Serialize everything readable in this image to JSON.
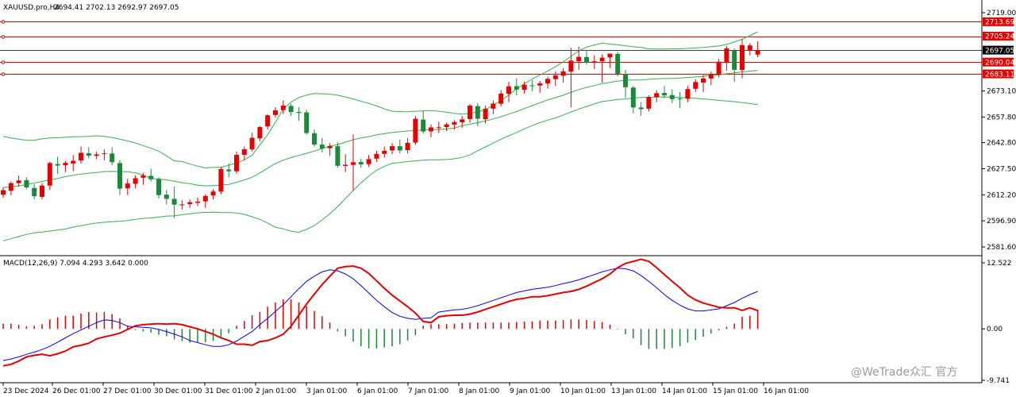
{
  "header": {
    "symbol_label": "XAUUSD.pro,H4",
    "ohlc_text": "2694.41 2702.13 2692.97 2697.05"
  },
  "macd_header": "MACD(12,26,9) 7.094 4.293 3.642 0.000",
  "watermark": "@WeTrade众汇 官方",
  "colors": {
    "bull": "#e60000",
    "bear": "#1a8a3a",
    "bollinger": "#33b24d",
    "level_line": "#e60000",
    "current_line": "#000000",
    "macd_line": "#0000ff",
    "signal_line": "#e60000",
    "hist_pos": "#e60000",
    "hist_neg": "#1a8a3a"
  },
  "price_axis": {
    "ticks": [
      "2719.00",
      "2673.10",
      "2657.80",
      "2642.80",
      "2627.50",
      "2612.20",
      "2596.90",
      "2581.60"
    ],
    "current_price": "2697.05",
    "levels": [
      "2713.69",
      "2705.24",
      "2690.04",
      "2683.11"
    ]
  },
  "macd_axis": {
    "ticks": [
      "12.522",
      "0.00",
      "-9.741"
    ]
  },
  "time_axis": {
    "labels": [
      "23 Dec 2024",
      "26 Dec 01:00",
      "27 Dec 01:00",
      "30 Dec 01:00",
      "31 Dec 01:00",
      "2 Jan 01:00",
      "3 Jan 01:00",
      "6 Jan 01:00",
      "7 Jan 01:00",
      "8 Jan 01:00",
      "9 Jan 01:00",
      "10 Jan 01:00",
      "13 Jan 01:00",
      "14 Jan 01:00",
      "15 Jan 01:00",
      "16 Jan 01:00"
    ]
  },
  "chart_data": {
    "type": "candlestick",
    "symbol": "XAUUSD.pro",
    "timeframe": "H4",
    "ylim": [
      2581.6,
      2720.0
    ],
    "candles": [
      [
        2612.2,
        2616.5,
        2610.5,
        2614.9
      ],
      [
        2614.5,
        2620.0,
        2612.0,
        2619.0
      ],
      [
        2619.0,
        2623.5,
        2617.0,
        2620.6
      ],
      [
        2620.8,
        2622.5,
        2615.5,
        2616.5
      ],
      [
        2616.2,
        2618.5,
        2609.5,
        2611.4
      ],
      [
        2611.0,
        2619.0,
        2609.5,
        2617.6
      ],
      [
        2617.6,
        2631.5,
        2615.0,
        2630.8
      ],
      [
        2630.2,
        2634.5,
        2624.5,
        2629.3
      ],
      [
        2629.5,
        2632.0,
        2625.5,
        2630.9
      ],
      [
        2630.5,
        2635.5,
        2626.0,
        2632.1
      ],
      [
        2632.3,
        2640.5,
        2630.5,
        2636.8
      ],
      [
        2636.6,
        2640.0,
        2633.5,
        2635.1
      ],
      [
        2635.0,
        2637.5,
        2633.0,
        2635.9
      ],
      [
        2636.2,
        2638.8,
        2632.5,
        2636.5
      ],
      [
        2636.4,
        2640.0,
        2629.5,
        2631.3
      ],
      [
        2630.8,
        2632.5,
        2612.0,
        2615.8
      ],
      [
        2616.0,
        2621.5,
        2612.0,
        2618.8
      ],
      [
        2618.6,
        2623.5,
        2616.0,
        2621.9
      ],
      [
        2622.2,
        2625.0,
        2618.0,
        2623.5
      ],
      [
        2623.3,
        2627.5,
        2620.0,
        2621.3
      ],
      [
        2621.4,
        2622.5,
        2610.0,
        2612.0
      ],
      [
        2612.3,
        2615.0,
        2606.5,
        2609.8
      ],
      [
        2609.8,
        2617.0,
        2598.5,
        2606.4
      ],
      [
        2606.0,
        2609.0,
        2603.5,
        2606.5
      ],
      [
        2606.7,
        2609.5,
        2604.5,
        2607.8
      ],
      [
        2607.5,
        2610.5,
        2605.5,
        2608.2
      ],
      [
        2608.3,
        2612.5,
        2604.5,
        2611.5
      ],
      [
        2611.8,
        2615.5,
        2609.5,
        2614.1
      ],
      [
        2614.1,
        2628.5,
        2612.5,
        2627.3
      ],
      [
        2627.0,
        2630.5,
        2622.5,
        2626.0
      ],
      [
        2626.0,
        2637.5,
        2624.5,
        2635.6
      ],
      [
        2635.6,
        2640.5,
        2632.5,
        2638.9
      ],
      [
        2638.8,
        2648.5,
        2637.5,
        2645.6
      ],
      [
        2645.3,
        2652.5,
        2643.5,
        2651.9
      ],
      [
        2652.3,
        2659.5,
        2650.5,
        2658.8
      ],
      [
        2659.0,
        2663.5,
        2657.5,
        2661.7
      ],
      [
        2661.9,
        2667.5,
        2659.5,
        2664.5
      ],
      [
        2664.3,
        2665.5,
        2658.5,
        2660.7
      ],
      [
        2660.8,
        2663.5,
        2655.5,
        2660.2
      ],
      [
        2660.5,
        2662.0,
        2647.5,
        2648.4
      ],
      [
        2648.3,
        2650.5,
        2640.5,
        2641.6
      ],
      [
        2641.6,
        2645.5,
        2637.0,
        2639.3
      ],
      [
        2639.5,
        2642.5,
        2635.0,
        2640.8
      ],
      [
        2640.7,
        2643.0,
        2628.0,
        2629.2
      ],
      [
        2629.1,
        2636.0,
        2625.5,
        2629.8
      ],
      [
        2629.7,
        2647.5,
        2614.5,
        2631.3
      ],
      [
        2631.4,
        2633.5,
        2628.0,
        2630.0
      ],
      [
        2630.2,
        2635.5,
        2628.5,
        2633.1
      ],
      [
        2633.4,
        2638.0,
        2631.5,
        2636.1
      ],
      [
        2636.2,
        2640.5,
        2634.0,
        2638.0
      ],
      [
        2638.2,
        2642.5,
        2636.0,
        2640.7
      ],
      [
        2640.7,
        2644.5,
        2636.5,
        2638.2
      ],
      [
        2638.4,
        2645.5,
        2636.5,
        2642.7
      ],
      [
        2642.8,
        2658.5,
        2641.5,
        2656.8
      ],
      [
        2656.3,
        2661.5,
        2648.0,
        2649.3
      ],
      [
        2649.4,
        2653.5,
        2646.0,
        2651.7
      ],
      [
        2651.5,
        2655.0,
        2648.5,
        2651.8
      ],
      [
        2651.9,
        2654.5,
        2649.5,
        2653.5
      ],
      [
        2653.4,
        2656.0,
        2650.5,
        2654.8
      ],
      [
        2654.7,
        2658.5,
        2651.5,
        2656.4
      ],
      [
        2656.6,
        2665.5,
        2654.5,
        2664.5
      ],
      [
        2664.2,
        2666.0,
        2652.5,
        2656.8
      ],
      [
        2656.5,
        2664.5,
        2654.0,
        2662.7
      ],
      [
        2662.7,
        2667.5,
        2659.5,
        2665.7
      ],
      [
        2665.6,
        2673.5,
        2664.0,
        2671.6
      ],
      [
        2671.4,
        2678.5,
        2666.5,
        2675.8
      ],
      [
        2675.9,
        2680.5,
        2670.5,
        2673.9
      ],
      [
        2673.8,
        2678.5,
        2671.5,
        2676.7
      ],
      [
        2676.4,
        2679.5,
        2673.0,
        2676.3
      ],
      [
        2676.3,
        2679.0,
        2672.0,
        2677.6
      ],
      [
        2677.5,
        2681.5,
        2674.5,
        2680.2
      ],
      [
        2680.0,
        2684.5,
        2676.0,
        2682.2
      ],
      [
        2682.0,
        2686.5,
        2678.0,
        2684.6
      ],
      [
        2684.4,
        2698.5,
        2663.5,
        2690.9
      ],
      [
        2690.5,
        2699.0,
        2685.5,
        2693.1
      ],
      [
        2693.0,
        2697.0,
        2688.5,
        2689.7
      ],
      [
        2689.7,
        2694.0,
        2686.0,
        2690.5
      ],
      [
        2690.6,
        2694.5,
        2678.0,
        2692.6
      ],
      [
        2692.8,
        2694.5,
        2686.5,
        2695.0
      ],
      [
        2694.8,
        2696.0,
        2681.5,
        2683.1
      ],
      [
        2683.0,
        2685.5,
        2669.0,
        2675.3
      ],
      [
        2675.1,
        2676.0,
        2660.0,
        2663.4
      ],
      [
        2663.4,
        2666.5,
        2658.5,
        2662.4
      ],
      [
        2662.7,
        2670.5,
        2661.0,
        2669.6
      ],
      [
        2669.5,
        2673.5,
        2666.5,
        2671.8
      ],
      [
        2671.9,
        2676.0,
        2669.0,
        2670.5
      ],
      [
        2670.7,
        2674.0,
        2666.0,
        2668.3
      ],
      [
        2668.6,
        2672.5,
        2663.0,
        2668.2
      ],
      [
        2668.5,
        2676.0,
        2666.5,
        2674.2
      ],
      [
        2674.4,
        2680.0,
        2672.5,
        2678.3
      ],
      [
        2678.0,
        2682.5,
        2672.5,
        2680.4
      ],
      [
        2680.4,
        2684.5,
        2676.5,
        2683.1
      ],
      [
        2682.6,
        2692.0,
        2681.0,
        2690.3
      ],
      [
        2689.8,
        2699.5,
        2685.0,
        2698.1
      ],
      [
        2696.8,
        2698.0,
        2678.5,
        2685.5
      ],
      [
        2685.4,
        2703.5,
        2680.5,
        2700.0
      ],
      [
        2697.0,
        2701.0,
        2694.0,
        2699.8
      ],
      [
        2694.41,
        2702.13,
        2692.97,
        2697.05
      ]
    ],
    "bollinger": {
      "upper": [
        2646.5,
        2645.5,
        2644.8,
        2644.2,
        2644.2,
        2645.0,
        2645.5,
        2645.7,
        2645.9,
        2646.2,
        2646.3,
        2646.5,
        2646.8,
        2646.5,
        2645.8,
        2644.8,
        2643.8,
        2642.6,
        2641.1,
        2639.5,
        2637.8,
        2635.0,
        2632.1,
        2631.7,
        2630.2,
        2629.0,
        2627.9,
        2628.3,
        2628.3,
        2629.5,
        2630.8,
        2632.7,
        2635.4,
        2641.5,
        2647.5,
        2654.8,
        2662.5,
        2666.5,
        2669.2,
        2670.7,
        2671.6,
        2671.5,
        2671.2,
        2670.6,
        2669.6,
        2668.4,
        2667.0,
        2665.8,
        2664.3,
        2662.6,
        2661.2,
        2661.0,
        2660.9,
        2661.2,
        2661.4,
        2661.6,
        2661.2,
        2660.6,
        2660.0,
        2659.5,
        2660.0,
        2660.8,
        2662.2,
        2664.8,
        2667.4,
        2670.7,
        2674.3,
        2677.3,
        2680.1,
        2682.5,
        2684.8,
        2687.3,
        2690.2,
        2693.4,
        2696.7,
        2698.8,
        2700.1,
        2701.1,
        2700.6,
        2700.2,
        2699.6,
        2699.0,
        2698.6,
        2697.8,
        2697.7,
        2697.7,
        2697.8,
        2697.8,
        2698.1,
        2698.3,
        2698.6,
        2699.0,
        2699.5,
        2700.4,
        2701.8,
        2703.5,
        2705.5,
        2707.8
      ],
      "middle": [
        2616.4,
        2616.9,
        2617.4,
        2618.2,
        2619.1,
        2620.0,
        2620.9,
        2621.8,
        2622.8,
        2623.6,
        2624.3,
        2624.8,
        2625.3,
        2625.8,
        2625.9,
        2625.8,
        2625.7,
        2625.1,
        2623.7,
        2621.8,
        2621.4,
        2620.9,
        2620.1,
        2619.3,
        2618.7,
        2617.8,
        2617.4,
        2617.6,
        2617.9,
        2618.3,
        2619.5,
        2620.9,
        2622.5,
        2625.0,
        2627.8,
        2630.5,
        2632.5,
        2634.0,
        2635.3,
        2636.5,
        2637.8,
        2639.3,
        2640.7,
        2641.7,
        2643.1,
        2644.5,
        2645.5,
        2646.3,
        2647.3,
        2648.1,
        2648.7,
        2649.2,
        2649.6,
        2649.9,
        2650.3,
        2650.5,
        2650.5,
        2650.8,
        2651.3,
        2652.7,
        2653.6,
        2654.5,
        2655.5,
        2656.7,
        2658.0,
        2659.5,
        2661.0,
        2662.8,
        2664.5,
        2666.2,
        2667.8,
        2669.2,
        2670.6,
        2672.4,
        2673.9,
        2675.2,
        2676.3,
        2677.4,
        2678.1,
        2678.9,
        2679.3,
        2679.5,
        2679.6,
        2679.9,
        2680.2,
        2680.4,
        2680.4,
        2680.7,
        2681.0,
        2681.3,
        2681.7,
        2682.2,
        2682.6,
        2683.2,
        2683.7,
        2684.3,
        2684.7,
        2685.2
      ],
      "lower": [
        2585.2,
        2586.4,
        2587.7,
        2588.9,
        2589.9,
        2590.3,
        2590.9,
        2591.5,
        2592.1,
        2593.3,
        2594.1,
        2594.9,
        2595.6,
        2596.1,
        2596.4,
        2596.7,
        2597.1,
        2597.8,
        2598.3,
        2598.6,
        2599.1,
        2599.7,
        2599.8,
        2600.5,
        2601.0,
        2601.6,
        2601.9,
        2602.0,
        2601.7,
        2601.7,
        2601.5,
        2600.7,
        2599.3,
        2597.8,
        2595.6,
        2593.1,
        2592.2,
        2590.8,
        2590.2,
        2591.9,
        2594.2,
        2597.4,
        2601.0,
        2605.3,
        2610.0,
        2614.7,
        2619.2,
        2623.1,
        2626.6,
        2628.9,
        2630.7,
        2631.1,
        2631.7,
        2632.1,
        2632.5,
        2632.7,
        2632.7,
        2632.9,
        2633.3,
        2634.1,
        2635.6,
        2638.0,
        2640.3,
        2642.5,
        2644.8,
        2646.8,
        2648.7,
        2650.8,
        2652.8,
        2654.5,
        2656.0,
        2657.3,
        2659.0,
        2660.8,
        2662.5,
        2664.0,
        2665.5,
        2666.9,
        2667.5,
        2668.1,
        2668.4,
        2668.9,
        2669.2,
        2669.4,
        2669.5,
        2669.6,
        2669.5,
        2669.3,
        2669.1,
        2668.8,
        2668.4,
        2668.0,
        2667.6,
        2667.2,
        2666.8,
        2666.3,
        2665.7,
        2665.0
      ]
    },
    "horizontal_levels": [
      2713.69,
      2705.24,
      2690.04,
      2683.11
    ],
    "current_price": 2697.05,
    "macd": {
      "params": "12,26,9",
      "ylim": [
        -9.741,
        12.522
      ],
      "histogram": [
        1.0,
        1.0,
        0.8,
        0.5,
        0.6,
        0.9,
        1.8,
        2.2,
        2.5,
        2.5,
        2.9,
        3.2,
        3.1,
        3.2,
        2.8,
        2.0,
        0.6,
        -0.2,
        -0.5,
        -0.7,
        -1.1,
        -1.4,
        -2.0,
        -2.3,
        -2.6,
        -2.6,
        -2.5,
        -2.3,
        -1.6,
        -0.8,
        0.6,
        1.5,
        2.6,
        3.2,
        4.2,
        5.0,
        5.6,
        5.6,
        5.0,
        4.3,
        3.4,
        2.4,
        1.2,
        -0.5,
        -1.4,
        -2.4,
        -3.3,
        -3.7,
        -3.7,
        -3.5,
        -3.3,
        -2.9,
        -2.2,
        -1.2,
        0.6,
        0.9,
        0.9,
        0.9,
        1.0,
        1.1,
        1.2,
        1.2,
        1.2,
        1.2,
        1.2,
        1.2,
        1.3,
        1.4,
        1.4,
        1.6,
        1.6,
        1.6,
        1.7,
        1.8,
        1.8,
        1.7,
        1.5,
        1.3,
        0.8,
        -0.1,
        -1.0,
        -1.8,
        -3.1,
        -3.8,
        -3.8,
        -3.8,
        -3.6,
        -3.3,
        -2.6,
        -2.1,
        -1.5,
        -0.9,
        -0.3,
        0.4,
        1.0,
        2.3,
        2.5,
        3.64
      ],
      "macd_line": [
        -6.0,
        -5.7,
        -5.3,
        -4.8,
        -4.4,
        -3.9,
        -3.3,
        -2.5,
        -1.7,
        -0.9,
        -0.2,
        0.5,
        1.2,
        1.7,
        1.6,
        1.2,
        0.5,
        0.4,
        0.3,
        0.2,
        -0.1,
        -0.5,
        -1.0,
        -1.5,
        -2.2,
        -2.6,
        -3.0,
        -3.3,
        -3.3,
        -3.0,
        -2.3,
        -1.4,
        -0.5,
        0.8,
        2.0,
        3.3,
        4.6,
        6.1,
        7.6,
        9.0,
        10.0,
        10.8,
        11.2,
        11.0,
        10.4,
        9.5,
        8.2,
        6.8,
        5.4,
        4.2,
        3.1,
        2.4,
        2.0,
        1.8,
        2.0,
        2.1,
        3.2,
        3.4,
        3.6,
        3.7,
        4.0,
        4.4,
        4.9,
        5.4,
        5.9,
        6.4,
        6.9,
        7.2,
        7.5,
        7.7,
        7.9,
        8.2,
        8.6,
        8.9,
        9.3,
        9.8,
        10.3,
        10.8,
        11.2,
        11.5,
        11.4,
        11.0,
        10.1,
        9.0,
        7.8,
        6.5,
        5.4,
        4.5,
        3.8,
        3.4,
        3.4,
        3.6,
        3.8,
        4.4,
        5.0,
        5.8,
        6.5,
        7.1
      ]
    }
  }
}
